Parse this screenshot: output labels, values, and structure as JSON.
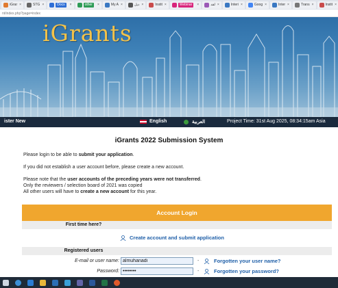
{
  "browser": {
    "tabs": [
      {
        "label": "iGrar",
        "tag": "",
        "fav_color": "#e07a2f"
      },
      {
        "label": "STG",
        "tag": "",
        "fav_color": "#666666"
      },
      {
        "label": "",
        "tag": "Docs",
        "tag_color": "#2f6fd6",
        "fav_color": "#2f6fd6"
      },
      {
        "label": "",
        "tag": "other",
        "tag_color": "#2e9b57",
        "fav_color": "#2e9b57"
      },
      {
        "label": "My A",
        "tag": "",
        "fav_color": "#3a78c2"
      },
      {
        "label": "ديل",
        "tag": "",
        "fav_color": "#555555"
      },
      {
        "label": "Instit",
        "tag": "",
        "fav_color": "#c94c4c"
      },
      {
        "label": "",
        "tag": "Webinar",
        "tag_color": "#d8267c",
        "fav_color": "#d8267c"
      },
      {
        "label": "لقد",
        "tag": "",
        "fav_color": "#9b59b6"
      },
      {
        "label": "Interi",
        "tag": "",
        "fav_color": "#3a78c2"
      },
      {
        "label": "Goog",
        "tag": "",
        "fav_color": "#4285f4"
      },
      {
        "label": "Inter",
        "tag": "",
        "fav_color": "#3a78c2"
      },
      {
        "label": "Trans",
        "tag": "",
        "fav_color": "#777777"
      },
      {
        "label": "Instit",
        "tag": "",
        "fav_color": "#c94c4c"
      }
    ],
    "url": "nt/index.php?page=index"
  },
  "banner": {
    "logo": "iGrants"
  },
  "nav": {
    "register": "ister New",
    "english": "English",
    "arabic": "العربية",
    "project_time": "Project Time: 31st Aug 2025, 08:34:15am Asia"
  },
  "main": {
    "title": "iGrants 2022 Submission System",
    "line1_pre": "Please login to be able to ",
    "line1_bold": "submit your application",
    "line1_post": ".",
    "line2": "If you did not establish a user account before, please create a new account.",
    "line3_pre": "Please note that the ",
    "line3_bold": "user accounts of the preceding years were not transferred",
    "line3_post": ".",
    "line4": "Only the reviewers / selection board of 2021 was copied",
    "line5_pre": "All other users will have to ",
    "line5_bold": "create a new account",
    "line5_post": " for this year."
  },
  "login": {
    "header": "Account Login",
    "first_time": "First time here?",
    "create_link": "Create account and submit application",
    "registered": "Registered users",
    "email_label": "E-mail or user name:",
    "email_value": "almuhanadi",
    "password_label": "Password:",
    "password_value": "••••••••",
    "forgot_user": "Forgotten your user name?",
    "forgot_password": "Forgotten your password?",
    "dash": "-"
  },
  "colors": {
    "accent_orange": "#f0a62e",
    "link_blue": "#1f5fa8",
    "nav_dark": "#1a2a3d",
    "logo_gold": "#f3c24a"
  }
}
